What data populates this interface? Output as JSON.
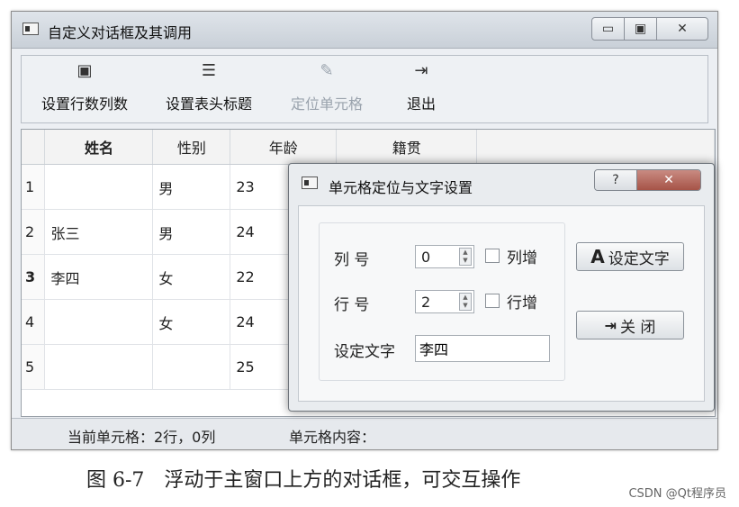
{
  "window": {
    "title": "自定义对话框及其调用",
    "controls": {
      "minimize": "▭",
      "maximize": "▣",
      "close": "✕"
    }
  },
  "toolbar": {
    "items": [
      {
        "label": "设置行数列数",
        "icon": "grid-icon"
      },
      {
        "label": "设置表头标题",
        "icon": "list-icon"
      },
      {
        "label": "定位单元格",
        "icon": "locate-icon",
        "disabled": true
      },
      {
        "label": "退出",
        "icon": "exit-icon"
      }
    ]
  },
  "table": {
    "headers": [
      "姓名",
      "性别",
      "年龄",
      "籍贯"
    ],
    "rows": [
      {
        "num": "1",
        "name": "",
        "gender": "男",
        "age": "23"
      },
      {
        "num": "2",
        "name": "张三",
        "gender": "男",
        "age": "24"
      },
      {
        "num": "3",
        "name": "李四",
        "gender": "女",
        "age": "22"
      },
      {
        "num": "4",
        "name": "",
        "gender": "女",
        "age": "24"
      },
      {
        "num": "5",
        "name": "",
        "gender": "",
        "age": "25"
      }
    ]
  },
  "status": {
    "current_cell": "当前单元格：2行，0列",
    "cell_content": "单元格内容："
  },
  "dialog": {
    "title": "单元格定位与文字设置",
    "help": "?",
    "close": "✕",
    "col_label": "列 号",
    "col_value": "0",
    "col_inc_label": "列增",
    "row_label": "行 号",
    "row_value": "2",
    "row_inc_label": "行增",
    "text_label": "设定文字",
    "text_value": "李四",
    "set_text_button": "设定文字",
    "set_text_icon_glyph": "A",
    "close_button": "关 闭"
  },
  "caption": "图 6-7　浮动于主窗口上方的对话框，可交互操作",
  "watermark": "CSDN @Qt程序员"
}
